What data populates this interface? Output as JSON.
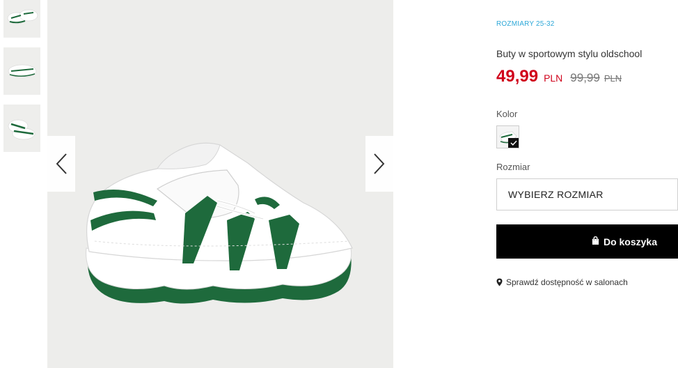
{
  "product": {
    "size_range": "ROZMIARY 25-32",
    "title": "Buty w sportowym stylu oldschool",
    "price_new": "49,99",
    "currency_new": "PLN",
    "price_old": "99,99",
    "currency_old": "PLN"
  },
  "color": {
    "label": "Kolor",
    "selected_icon": "check-icon"
  },
  "size": {
    "label": "Rozmiar",
    "select_placeholder": "WYBIERZ ROZMIAR"
  },
  "cart": {
    "button_label": "Do koszyka",
    "icon": "shopping-bag-icon"
  },
  "availability": {
    "label": "Sprawdź dostępność w salonach",
    "icon": "map-pin-icon"
  },
  "gallery": {
    "prev_icon": "chevron-left-icon",
    "next_icon": "chevron-right-icon"
  },
  "colors": {
    "price_accent": "#d0021b",
    "link_accent": "#2ea8d8",
    "shoe_green": "#1e6a3c"
  }
}
